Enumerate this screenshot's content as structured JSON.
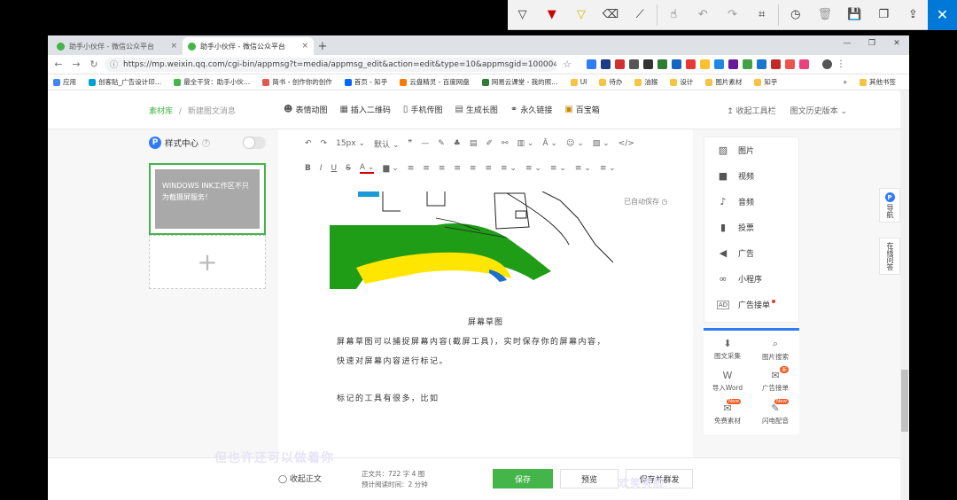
{
  "ink_toolbar": {
    "tools": [
      "pen-down-icon",
      "pen-red-icon",
      "highlighter-icon",
      "eraser-icon",
      "ruler-icon",
      "touch-writing-icon",
      "undo-icon",
      "redo-icon",
      "crop-icon",
      "history-icon",
      "delete-icon",
      "save-icon",
      "copy-icon",
      "share-icon"
    ],
    "close_glyph": "✕"
  },
  "tabs": [
    {
      "label": "助手小伙伴 - 微信公众平台",
      "close": "×"
    },
    {
      "label": "助手小伙伴 - 微信公众平台",
      "close": "×"
    }
  ],
  "newtab": "+",
  "window_controls": [
    "—",
    "❐",
    "✕"
  ],
  "address": {
    "url": "https://mp.weixin.qq.com/cgi-bin/appmsg?t=media/appmsg_edit&action=edit&type=10&appmsgid=100004...",
    "star": "☆"
  },
  "bookmarks": [
    "应用",
    "创客贴_广告设计印…",
    "最全干货：助手小伙…",
    "简书 - 创作你的创作",
    "首页 - 知乎",
    "云盘精灵 - 百度网盘",
    "网易云课堂 - 我的照…",
    "UI",
    "待办",
    "油猴",
    "设计",
    "图片素材",
    "知乎"
  ],
  "bookmarks_more": "»",
  "bookmarks_other": "其他书签",
  "mp": {
    "breadcrumb": {
      "root": "素材库",
      "sep": "/",
      "current": "新建图文消息"
    },
    "tools": [
      {
        "icon": "☻",
        "label": "表情动图"
      },
      {
        "icon": "▦",
        "label": "插入二维码"
      },
      {
        "icon": "▯",
        "label": "手机传图"
      },
      {
        "icon": "▤",
        "label": "生成长图"
      },
      {
        "icon": "⚭",
        "label": "永久链接"
      },
      {
        "icon": "▣",
        "label": "百宝箱"
      }
    ],
    "header_right": [
      "↥ 收起工具栏",
      "图文历史版本 ⌄"
    ],
    "style_center": {
      "badge": "P",
      "label": "样式中心",
      "help": "?"
    },
    "article_card_text": "WINDOWS INK工作区不只为截摄屏服务！",
    "add_symbol": "+",
    "format_row1": [
      "↶",
      "↷",
      "15px ⌄",
      "默认 ⌄",
      "❞",
      "—",
      "✎",
      "♣",
      "▤",
      "✐",
      "⚯",
      "▥ ⌄",
      "Ā ⌄",
      "☺ ⌄",
      "▨ ⌄",
      "</>"
    ],
    "format_row2": [
      "B",
      "I",
      "U",
      "S",
      "A ⌄",
      "▆ ⌄",
      "≡",
      "≡",
      "≡",
      "≡",
      "≡",
      "≡",
      "≡ ⌄",
      "≡ ⌄",
      "≡ ⌄",
      "≡ ⌄",
      "≡ ⌄"
    ],
    "autosave": "已自动保存 ◷",
    "caption": "屏幕草图",
    "paragraphs": [
      "屏幕草图可以捕捉屏幕内容(截屏工具)，实时保存你的屏幕内容，",
      "快速对屏幕内容进行标记。",
      "标记的工具有很多，比如"
    ],
    "right_items": [
      {
        "icon": "▨",
        "label": "图片"
      },
      {
        "icon": "■",
        "label": "视频"
      },
      {
        "icon": "♪",
        "label": "音频"
      },
      {
        "icon": "▮",
        "label": "投票"
      },
      {
        "icon": "◀",
        "label": "广告"
      },
      {
        "icon": "∞",
        "label": "小程序"
      },
      {
        "icon": "AD",
        "label": "广告接单"
      }
    ],
    "right_grid": [
      {
        "icon": "⬇",
        "label": "图文采集",
        "badge": ""
      },
      {
        "icon": "⌕",
        "label": "图片搜索",
        "badge": ""
      },
      {
        "icon": "W",
        "label": "导入Word",
        "badge": ""
      },
      {
        "icon": "✉",
        "label": "广告接单",
        "badge": "新"
      },
      {
        "icon": "✉",
        "label": "免费素材",
        "badge": "New"
      },
      {
        "icon": "✎",
        "label": "闪电配音",
        "badge": "New"
      }
    ],
    "float_nav": {
      "badge": "P",
      "label": "导航"
    },
    "float_help": "在线问答",
    "footer": {
      "fold": "◯ 收起正文",
      "stats_line1": "正文共：722 字 4 图",
      "stats_line2": "预计阅读时间：2 分钟",
      "save": "保存",
      "preview": "预览",
      "publish": "保存并群发"
    }
  },
  "overlay": {
    "left": "但也许还可以做着你",
    "right": "欢笑笑脸"
  }
}
